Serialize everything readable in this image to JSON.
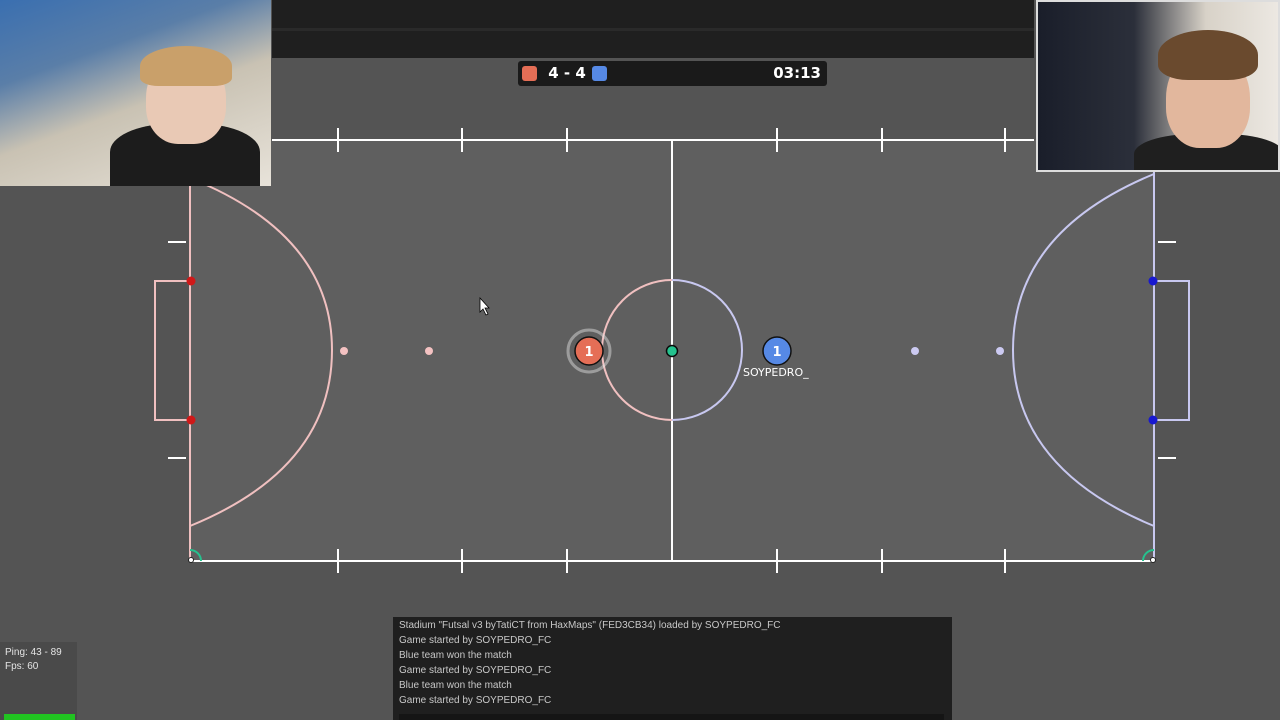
{
  "scoreboard": {
    "red_score": 4,
    "blue_score": 4,
    "score_text": "4 - 4",
    "timer": "03:13",
    "red_color": "#e56e56",
    "blue_color": "#5689e5"
  },
  "field": {
    "background": "#5f5f5f",
    "line_color": "#ffffff",
    "red_line_color": "#f0c0c0",
    "blue_line_color": "#c8c8f0"
  },
  "players": [
    {
      "team": "red",
      "number": "1",
      "color": "#e56e56",
      "name": ""
    },
    {
      "team": "blue",
      "number": "1",
      "color": "#5689e5",
      "name": "SOYPEDRO_"
    }
  ],
  "ball": {
    "color": "#25c28e"
  },
  "chat": {
    "messages": [
      "Stadium \"Futsal v3 byTatiCT from HaxMaps\" (FED3CB34) loaded by SOYPEDRO_FC",
      "Game started by SOYPEDRO_FC",
      "Blue team won the match",
      "Game started by SOYPEDRO_FC",
      "Blue team won the match",
      "Game started by SOYPEDRO_FC"
    ]
  },
  "stats": {
    "ping": "Ping: 43 - 89",
    "fps": "Fps: 60"
  }
}
